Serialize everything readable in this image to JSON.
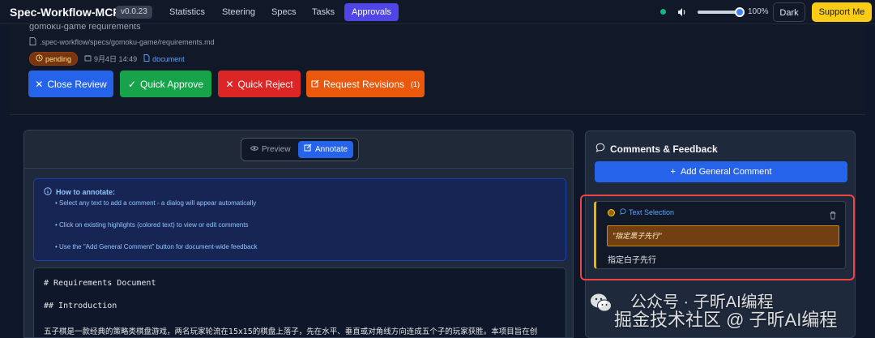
{
  "nav": {
    "brand": "Spec-Workflow-MCP",
    "version": "v0.0.23",
    "tabs": [
      {
        "label": "Statistics",
        "active": false
      },
      {
        "label": "Steering",
        "active": false
      },
      {
        "label": "Specs",
        "active": false
      },
      {
        "label": "Tasks",
        "active": false
      },
      {
        "label": "Approvals",
        "active": true
      }
    ],
    "volume_percent": 100,
    "volume_label": "100%",
    "theme_label": "Dark",
    "support_label": "Support Me",
    "status_color": "#10b981"
  },
  "document": {
    "title": "gomoku-game requirements",
    "path": ".spec-workflow/specs/gomoku-game/requirements.md",
    "status": "pending",
    "date": "9月4日 14:49",
    "type": "document"
  },
  "actions": {
    "close_review": "Close Review",
    "quick_approve": "Quick Approve",
    "quick_reject": "Quick Reject",
    "request_revisions": "Request Revisions",
    "revisions_count": "(1)"
  },
  "viewer": {
    "preview_label": "Preview",
    "annotate_label": "Annotate",
    "mode": "annotate"
  },
  "help": {
    "title": "How to annotate:",
    "lines": [
      "• Select any text to add a comment - a dialog will appear automatically",
      "• Click on existing highlights (colored text) to view or edit comments",
      "• Use the \"Add General Comment\" button for document-wide feedback"
    ]
  },
  "content": {
    "h1": "# Requirements Document",
    "h2": "## Introduction",
    "para": "五子棋是一款经典的策略类棋盘游戏，两名玩家轮流在15x15的棋盘上落子，先在水平、垂直或对角线方向连成五个子的玩家获胜。本项目旨在创"
  },
  "comments": {
    "title": "Comments & Feedback",
    "add_general": "Add General Comment",
    "items": [
      {
        "type": "Text Selection",
        "quote": "\"指定黑子先行\"",
        "text": "指定白子先行",
        "color": "#eab308"
      }
    ]
  },
  "watermark": {
    "line1": "公众号 · 子昕AI编程",
    "line2": "掘金技术社区 @ 子昕AI编程"
  }
}
